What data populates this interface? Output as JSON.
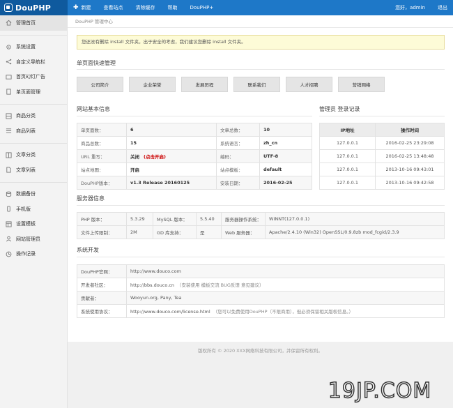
{
  "app": {
    "logo_text": "DouPHP"
  },
  "topnav": [
    {
      "label": "新建",
      "icon": "plus-icon"
    },
    {
      "label": "查看站点"
    },
    {
      "label": "清除缓存"
    },
    {
      "label": "帮助"
    },
    {
      "label": "DouPHP+"
    }
  ],
  "topright": {
    "greeting": "您好，admin",
    "logout": "退出"
  },
  "sidebar": {
    "items": [
      {
        "label": "管理首页",
        "icon": "home-icon"
      },
      {
        "label": "系统设置",
        "icon": "gear-icon"
      },
      {
        "label": "自定义导航栏",
        "icon": "share-icon"
      },
      {
        "label": "首页幻灯广告",
        "icon": "slides-icon"
      },
      {
        "label": "单页面管理",
        "icon": "page-icon"
      },
      {
        "label": "商品分类",
        "icon": "category-icon"
      },
      {
        "label": "商品列表",
        "icon": "list-icon"
      },
      {
        "label": "文章分类",
        "icon": "category-icon"
      },
      {
        "label": "文章列表",
        "icon": "doc-icon"
      },
      {
        "label": "数据备份",
        "icon": "database-icon"
      },
      {
        "label": "手机版",
        "icon": "mobile-icon"
      },
      {
        "label": "设置模板",
        "icon": "template-icon"
      },
      {
        "label": "网站管理员",
        "icon": "user-icon"
      },
      {
        "label": "操作记录",
        "icon": "record-icon"
      }
    ]
  },
  "breadcrumb": "DouPHP 管理中心",
  "notice": "您还没有删除 install 文件夹，出于安全的考虑，我们建议您删除 install 文件夹。",
  "quick": {
    "title": "单页面快速管理",
    "buttons": [
      "公司简介",
      "企业荣誉",
      "发展历程",
      "联系我们",
      "人才招聘",
      "营销网络"
    ]
  },
  "site_info": {
    "title": "网站基本信息",
    "rows": [
      [
        "单页面数：",
        "6",
        "文章总数：",
        "10"
      ],
      [
        "商品总数：",
        "15",
        "系统语言：",
        "zh_cn"
      ],
      [
        "URL 重写：",
        "关闭",
        "编码：",
        "UTF-8"
      ],
      [
        "站点地图：",
        "开启",
        "站点模板：",
        "default"
      ],
      [
        "DouPHP版本：",
        "v1.3 Release 20160125",
        "安装日期：",
        "2016-02-25"
      ]
    ],
    "url_warning": "(点击开启)"
  },
  "admin_log": {
    "title": "管理员  登录记录",
    "headers": [
      "IP地址",
      "操作时间"
    ],
    "rows": [
      [
        "127.0.0.1",
        "2016-02-25 23:29:08"
      ],
      [
        "127.0.0.1",
        "2016-02-25 13:48:48"
      ],
      [
        "127.0.0.1",
        "2013-10-16 09:43:01"
      ],
      [
        "127.0.0.1",
        "2013-10-16 09:42:58"
      ]
    ]
  },
  "server": {
    "title": "服务器信息",
    "rows": [
      [
        "PHP 版本：",
        "5.3.29",
        "MySQL 版本：",
        "5.5.40",
        "服务器操作系统：",
        "WINNT(127.0.0.1)"
      ],
      [
        "文件上传限制：",
        "2M",
        "GD 库支持：",
        "是",
        "Web 服务器：",
        "Apache/2.4.10 (Win32) OpenSSL/0.9.8zb mod_fcgid/2.3.9"
      ]
    ]
  },
  "sysdev": {
    "title": "系统开发",
    "rows": [
      {
        "label": "DouPHP官网：",
        "value": "http://www.douco.com",
        "note": ""
      },
      {
        "label": "开发者社区：",
        "value": "http://bbs.douco.cn",
        "note": "（安装使用 模板交流 BUG反馈 意见建议）"
      },
      {
        "label": "贡献者：",
        "value": "Wooyun.org, Pany, Tea",
        "note": ""
      },
      {
        "label": "系统使用协议：",
        "value": "http://www.douco.com/license.html",
        "note": "（您可以免费使用DouPHP（不限商用），但必须保留相关版权信息。）"
      }
    ]
  },
  "footer": "版权所有 © 2020 XXX网络科技有限公司，并保留所有权利。",
  "watermark": "19JP.COM"
}
